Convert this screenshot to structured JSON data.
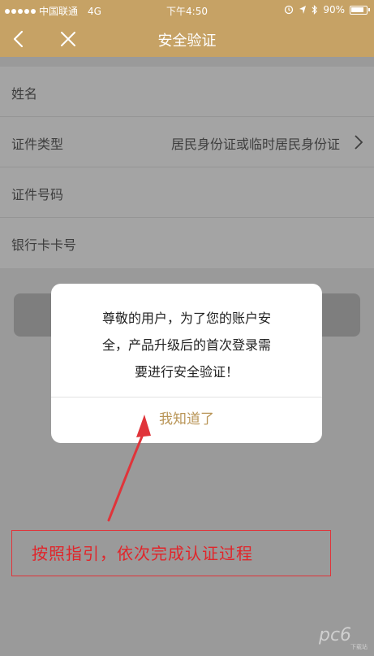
{
  "status_bar": {
    "carrier": "中国联通",
    "network": "4G",
    "time": "下午4:50",
    "battery": "90%"
  },
  "nav": {
    "title": "安全验证"
  },
  "form": {
    "rows": [
      {
        "label": "姓名",
        "value": ""
      },
      {
        "label": "证件类型",
        "value": "居民身份证或临时居民身份证"
      },
      {
        "label": "证件号码",
        "value": ""
      },
      {
        "label": "银行卡卡号",
        "value": ""
      }
    ]
  },
  "dialog": {
    "message_lines": [
      "尊敬的用户，为了您的账户安",
      "全，产品升级后的首次登录需",
      "要进行安全验证！"
    ],
    "button": "我知道了"
  },
  "annotation": {
    "text": "按照指引，依次完成认证过程",
    "color": "#e0262b"
  },
  "watermark": {
    "text": "pc6",
    "sub": "下载站"
  },
  "colors": {
    "header": "#c6a265",
    "accent": "#b99557"
  }
}
